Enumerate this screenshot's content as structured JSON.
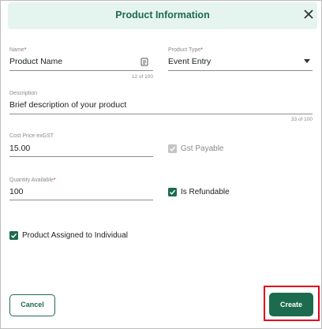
{
  "header": {
    "title": "Product Information"
  },
  "fields": {
    "name": {
      "label": "Name",
      "required_mark": "*",
      "value": "Product Name",
      "counter": "12 of 100"
    },
    "product_type": {
      "label": "Product Type",
      "required_mark": "*",
      "value": "Event Entry"
    },
    "description": {
      "label": "Description",
      "value": "Brief description of your product",
      "counter": "33 of 100"
    },
    "cost_price": {
      "label": "Cost Price exGST",
      "value": "15.00"
    },
    "quantity": {
      "label": "Quantity Available",
      "required_mark": "*",
      "value": "100"
    }
  },
  "checkboxes": {
    "gst": {
      "label": "Gst Payable",
      "checked": true,
      "disabled": true
    },
    "refundable": {
      "label": "Is Refundable",
      "checked": true
    },
    "assigned": {
      "label": "Product Assigned to Individual",
      "checked": true
    }
  },
  "actions": {
    "cancel": "Cancel",
    "create": "Create"
  },
  "colors": {
    "primary": "#1d6b4f",
    "header_bg": "#e6f4ef",
    "highlight": "#e0001b"
  }
}
